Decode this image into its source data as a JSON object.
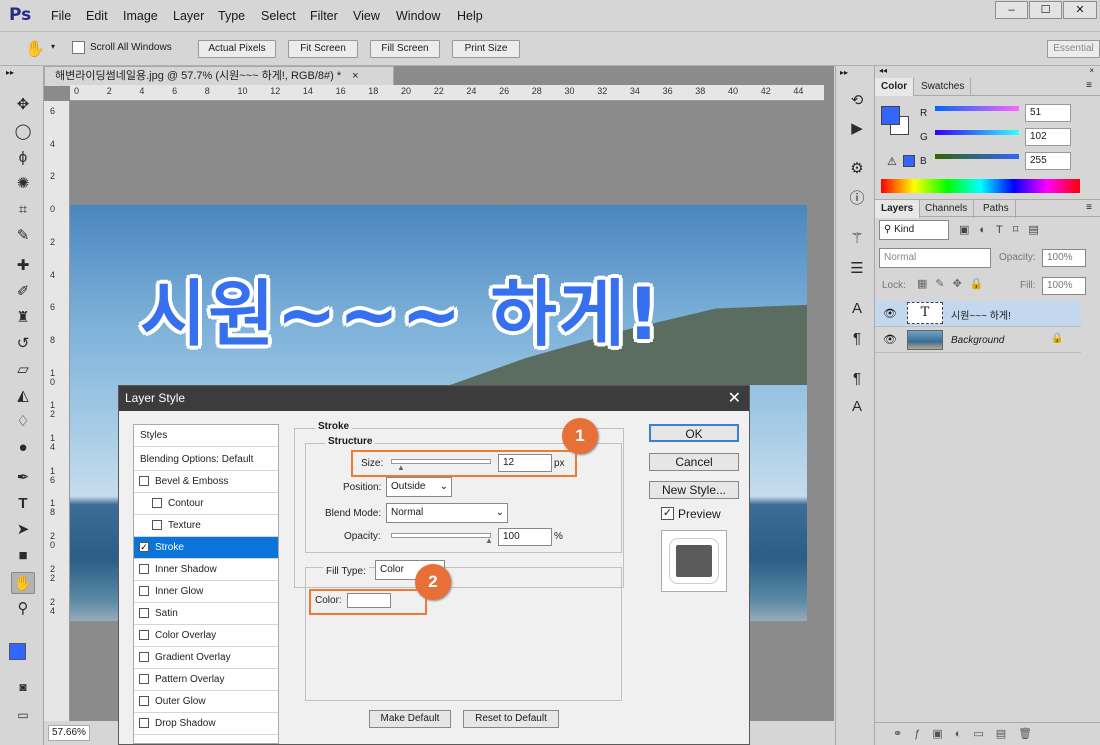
{
  "app": {
    "logo": "Ps",
    "menu": [
      "File",
      "Edit",
      "Image",
      "Layer",
      "Type",
      "Select",
      "Filter",
      "View",
      "Window",
      "Help"
    ],
    "window_buttons": [
      "–",
      "☐",
      "✕"
    ]
  },
  "options": {
    "scroll_all": "Scroll All Windows",
    "buttons": [
      "Actual Pixels",
      "Fit Screen",
      "Fill Screen",
      "Print Size"
    ],
    "workspace": "Essential"
  },
  "document": {
    "tab": "해변라이딩썸네일용.jpg @ 57.7% (시원~~~ 하게!, RGB/8#) *",
    "canvas_text": "시원~~~ 하게!",
    "zoom": "57.66%",
    "ruler_top": [
      "0",
      "2",
      "4",
      "6",
      "8",
      "10",
      "12",
      "14",
      "16",
      "18",
      "20",
      "22",
      "24",
      "26",
      "28",
      "30",
      "32",
      "34",
      "36",
      "38",
      "40",
      "42",
      "44"
    ],
    "ruler_left": [
      "6",
      "4",
      "2",
      "0",
      "2",
      "4",
      "6",
      "8",
      "10",
      "12",
      "14",
      "16",
      "18",
      "20",
      "22",
      "24"
    ]
  },
  "color_panel": {
    "tabs": [
      "Color",
      "Swatches"
    ],
    "r_label": "R",
    "g_label": "G",
    "b_label": "B",
    "r": "51",
    "g": "102",
    "b": "255",
    "fg_color": "#3366ff"
  },
  "layers_panel": {
    "tabs": [
      "Layers",
      "Channels",
      "Paths"
    ],
    "kind": "Kind",
    "blend": "Normal",
    "opacity_label": "Opacity:",
    "opacity": "100%",
    "lock_label": "Lock:",
    "fill_label": "Fill:",
    "fill": "100%",
    "layers": [
      {
        "name": "시원~~~ 하게!",
        "thumb": "T"
      },
      {
        "name": "Background"
      }
    ]
  },
  "dialog": {
    "title": "Layer Style",
    "close": "✕",
    "styles_header": "Styles",
    "blending": "Blending Options: Default",
    "items": [
      {
        "label": "Bevel & Emboss",
        "checked": false,
        "indent": false
      },
      {
        "label": "Contour",
        "checked": false,
        "indent": true
      },
      {
        "label": "Texture",
        "checked": false,
        "indent": true
      },
      {
        "label": "Stroke",
        "checked": true,
        "indent": false
      },
      {
        "label": "Inner Shadow",
        "checked": false,
        "indent": false
      },
      {
        "label": "Inner Glow",
        "checked": false,
        "indent": false
      },
      {
        "label": "Satin",
        "checked": false,
        "indent": false
      },
      {
        "label": "Color Overlay",
        "checked": false,
        "indent": false
      },
      {
        "label": "Gradient Overlay",
        "checked": false,
        "indent": false
      },
      {
        "label": "Pattern Overlay",
        "checked": false,
        "indent": false
      },
      {
        "label": "Outer Glow",
        "checked": false,
        "indent": false
      },
      {
        "label": "Drop Shadow",
        "checked": false,
        "indent": false
      }
    ],
    "stroke": "Stroke",
    "structure": "Structure",
    "size_label": "Size:",
    "size": "12",
    "size_unit": "px",
    "position_label": "Position:",
    "position": "Outside",
    "blend_label": "Blend Mode:",
    "blend": "Normal",
    "opacity_label": "Opacity:",
    "opacity": "100",
    "opacity_unit": "%",
    "fill_type_label": "Fill Type:",
    "fill_type": "Color",
    "color_label": "Color:",
    "make_default": "Make Default",
    "reset_default": "Reset to Default",
    "ok": "OK",
    "cancel": "Cancel",
    "new_style": "New Style...",
    "preview": "Preview",
    "badge1": "1",
    "badge2": "2"
  }
}
